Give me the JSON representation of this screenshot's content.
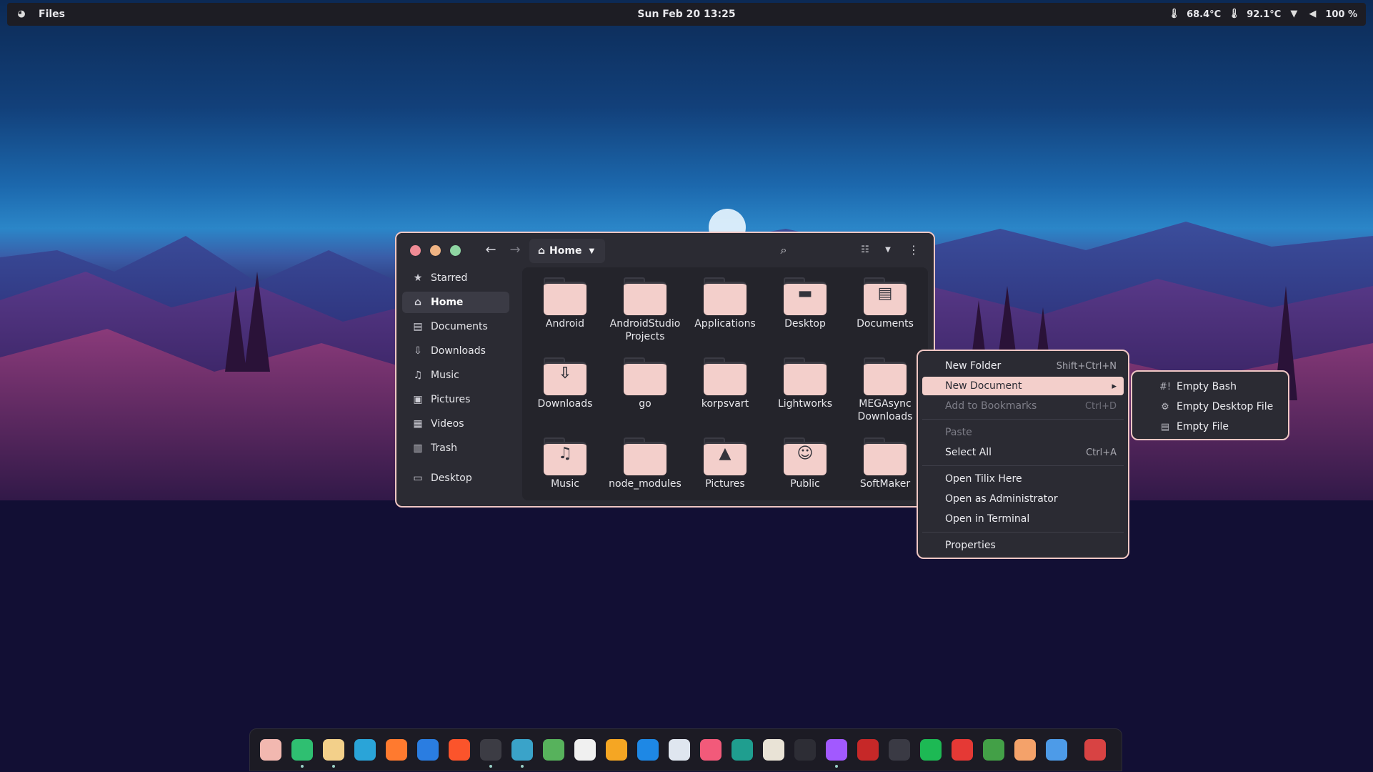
{
  "topbar": {
    "app_name": "Files",
    "datetime": "Sun Feb 20  13:25",
    "temp1": "68.4°C",
    "temp2": "92.1°C",
    "battery": "100 %"
  },
  "window": {
    "location": "Home",
    "sidebar": [
      {
        "label": "Starred",
        "icon": "star-icon"
      },
      {
        "label": "Home",
        "icon": "home-icon"
      },
      {
        "label": "Documents",
        "icon": "document-icon"
      },
      {
        "label": "Downloads",
        "icon": "download-icon"
      },
      {
        "label": "Music",
        "icon": "music-icon"
      },
      {
        "label": "Pictures",
        "icon": "picture-icon"
      },
      {
        "label": "Videos",
        "icon": "video-icon"
      },
      {
        "label": "Trash",
        "icon": "trash-icon"
      },
      {
        "label": "Desktop",
        "icon": "desktop-icon"
      }
    ],
    "files": [
      {
        "name": "Android",
        "glyph": ""
      },
      {
        "name": "AndroidStudio Projects",
        "glyph": ""
      },
      {
        "name": "Applications",
        "glyph": ""
      },
      {
        "name": "Desktop",
        "glyph": "▬"
      },
      {
        "name": "Documents",
        "glyph": "▤"
      },
      {
        "name": "Downloads",
        "glyph": "⇩"
      },
      {
        "name": "go",
        "glyph": ""
      },
      {
        "name": "korpsvart",
        "glyph": ""
      },
      {
        "name": "Lightworks",
        "glyph": ""
      },
      {
        "name": "MEGAsync Downloads",
        "glyph": ""
      },
      {
        "name": "Music",
        "glyph": "♫"
      },
      {
        "name": "node_modules",
        "glyph": ""
      },
      {
        "name": "Pictures",
        "glyph": "▲"
      },
      {
        "name": "Public",
        "glyph": "☺"
      },
      {
        "name": "SoftMaker",
        "glyph": ""
      }
    ]
  },
  "context_menu": [
    {
      "label": "New Folder",
      "accel": "Shift+Ctrl+N"
    },
    {
      "label": "New Document",
      "accel": "▸"
    },
    {
      "label": "Add to Bookmarks",
      "accel": "Ctrl+D"
    },
    {
      "label": "Paste",
      "accel": ""
    },
    {
      "label": "Select All",
      "accel": "Ctrl+A"
    },
    {
      "label": "Open Tilix Here",
      "accel": ""
    },
    {
      "label": "Open as Administrator",
      "accel": ""
    },
    {
      "label": "Open in Terminal",
      "accel": ""
    },
    {
      "label": "Properties",
      "accel": ""
    }
  ],
  "submenu": [
    {
      "label": "Empty Bash",
      "icon": "#!"
    },
    {
      "label": "Empty Desktop File",
      "icon": "⚙"
    },
    {
      "label": "Empty File",
      "icon": "▤"
    }
  ],
  "dock": {
    "apps": [
      {
        "name": "app-icon-1",
        "color": "#f2b8b0"
      },
      {
        "name": "app-icon-2",
        "color": "#2fbf71"
      },
      {
        "name": "files-icon",
        "color": "#f3d08a"
      },
      {
        "name": "telegram-icon",
        "color": "#2aa4d8"
      },
      {
        "name": "firefox-icon",
        "color": "#ff7a2f"
      },
      {
        "name": "app-icon-6",
        "color": "#2a7de1"
      },
      {
        "name": "brave-icon",
        "color": "#fb542b"
      },
      {
        "name": "terminal-icon",
        "color": "#3c3c44"
      },
      {
        "name": "app-icon-9",
        "color": "#3aa3c9"
      },
      {
        "name": "app-icon-10",
        "color": "#57b25c"
      },
      {
        "name": "app-icon-11",
        "color": "#f0f0f0"
      },
      {
        "name": "app-icon-12",
        "color": "#f5a623"
      },
      {
        "name": "app-icon-13",
        "color": "#1e88e5"
      },
      {
        "name": "app-icon-14",
        "color": "#dfe6ef"
      },
      {
        "name": "app-icon-15",
        "color": "#f25a7a"
      },
      {
        "name": "app-icon-16",
        "color": "#1f9e8f"
      },
      {
        "name": "app-icon-17",
        "color": "#e9e3d6"
      },
      {
        "name": "app-icon-18",
        "color": "#2d2d35"
      },
      {
        "name": "figma-icon",
        "color": "#a259ff"
      },
      {
        "name": "app-icon-20",
        "color": "#c62828"
      },
      {
        "name": "app-icon-21",
        "color": "#3a3a44"
      },
      {
        "name": "spotify-icon",
        "color": "#1db954"
      },
      {
        "name": "app-icon-23",
        "color": "#e53935"
      },
      {
        "name": "app-icon-24",
        "color": "#43a047"
      },
      {
        "name": "app-icon-25",
        "color": "#f4a26a"
      },
      {
        "name": "settings-icon",
        "color": "#4d9be8"
      },
      {
        "name": "trash-icon",
        "color": "#d84343"
      }
    ]
  }
}
